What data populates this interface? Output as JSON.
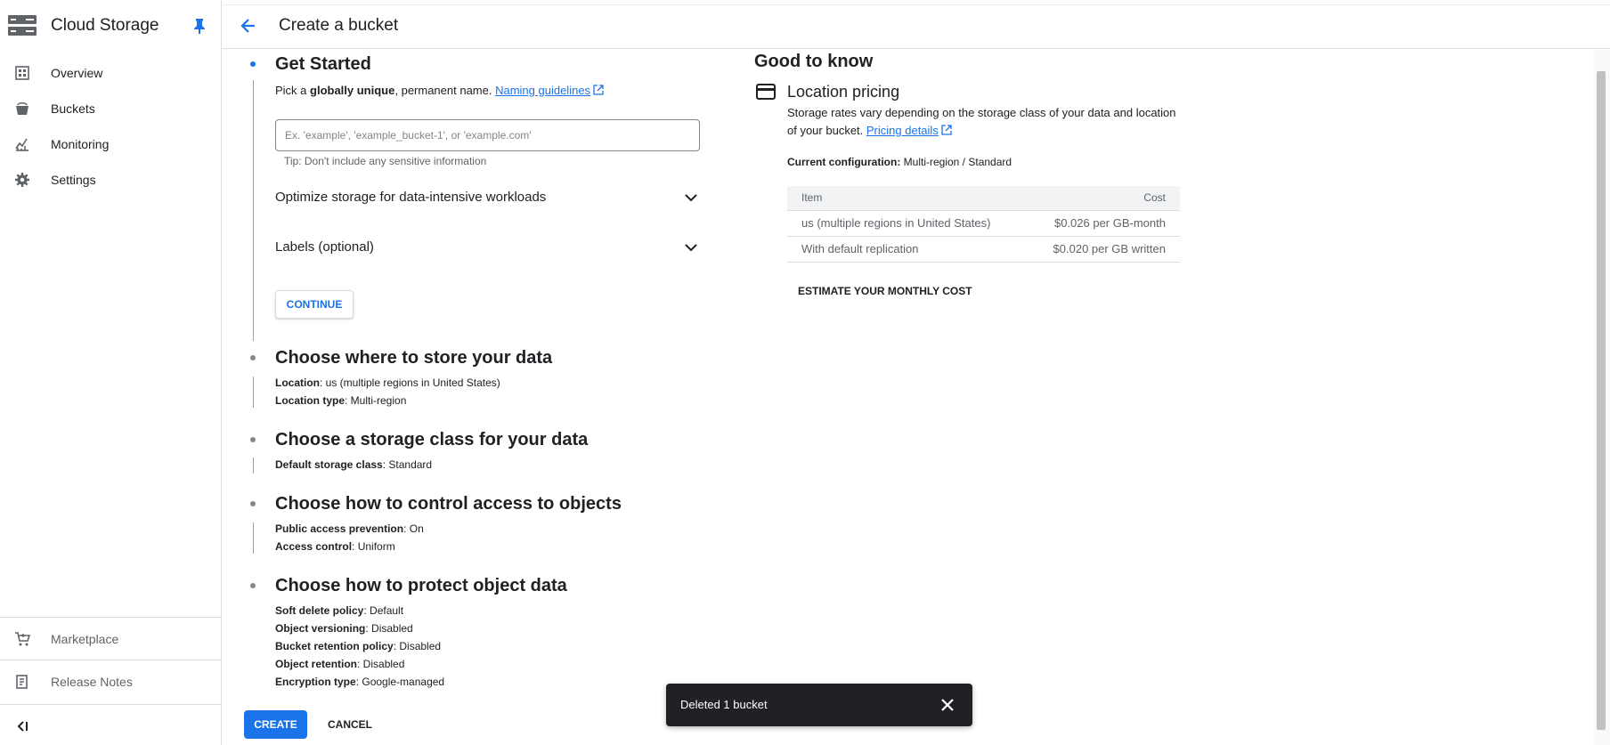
{
  "app": {
    "product_title": "Cloud Storage"
  },
  "sidebar": {
    "items": [
      {
        "label": "Overview",
        "icon": "dashboard-icon"
      },
      {
        "label": "Buckets",
        "icon": "bucket-icon"
      },
      {
        "label": "Monitoring",
        "icon": "monitoring-chart-icon"
      },
      {
        "label": "Settings",
        "icon": "gear-icon"
      }
    ],
    "footer_items": [
      {
        "label": "Marketplace",
        "icon": "cart-icon"
      },
      {
        "label": "Release Notes",
        "icon": "release-notes-icon"
      }
    ]
  },
  "header": {
    "title": "Create a bucket"
  },
  "steps": {
    "get_started": {
      "title": "Get Started",
      "intro_prefix": "Pick a ",
      "intro_bold": "globally unique",
      "intro_suffix": ", permanent name. ",
      "naming_link": "Naming guidelines",
      "name_placeholder": "Ex. 'example', 'example_bucket-1', or 'example.com'",
      "name_value": "",
      "tip": "Tip: Don't include any sensitive information",
      "optimize_label": "Optimize storage for data-intensive workloads",
      "labels_label": "Labels (optional)",
      "continue_label": "CONTINUE"
    },
    "location": {
      "title": "Choose where to store your data",
      "location_key": "Location",
      "location_value": ": us (multiple regions in United States)",
      "type_key": "Location type",
      "type_value": ": Multi-region"
    },
    "storage_class": {
      "title": "Choose a storage class for your data",
      "key": "Default storage class",
      "value": ": Standard"
    },
    "access": {
      "title": "Choose how to control access to objects",
      "pap_key": "Public access prevention",
      "pap_value": ": On",
      "ac_key": "Access control",
      "ac_value": ": Uniform"
    },
    "protect": {
      "title": "Choose how to protect object data",
      "rows": [
        {
          "key": "Soft delete policy",
          "value": ": Default"
        },
        {
          "key": "Object versioning",
          "value": ": Disabled"
        },
        {
          "key": "Bucket retention policy",
          "value": ": Disabled"
        },
        {
          "key": "Object retention",
          "value": ": Disabled"
        },
        {
          "key": "Encryption type",
          "value": ": Google-managed"
        }
      ]
    }
  },
  "actions": {
    "create_label": "CREATE",
    "cancel_label": "CANCEL"
  },
  "info_panel": {
    "title": "Good to know",
    "section_title": "Location pricing",
    "desc_text": "Storage rates vary depending on the storage class of your data and location of your bucket. ",
    "pricing_link": "Pricing details",
    "config_key": "Current configuration:",
    "config_value": " Multi-region / Standard",
    "table": {
      "headers": [
        "Item",
        "Cost"
      ],
      "rows": [
        [
          "us (multiple regions in United States)",
          "$0.026 per GB-month"
        ],
        [
          "With default replication",
          "$0.020 per GB written"
        ]
      ]
    },
    "estimate_label": "ESTIMATE YOUR MONTHLY COST"
  },
  "snackbar": {
    "message": "Deleted 1 bucket"
  },
  "colors": {
    "accent": "#1a73e8",
    "text": "#202124",
    "muted": "#5f6368",
    "snackbar_bg": "#202124"
  }
}
